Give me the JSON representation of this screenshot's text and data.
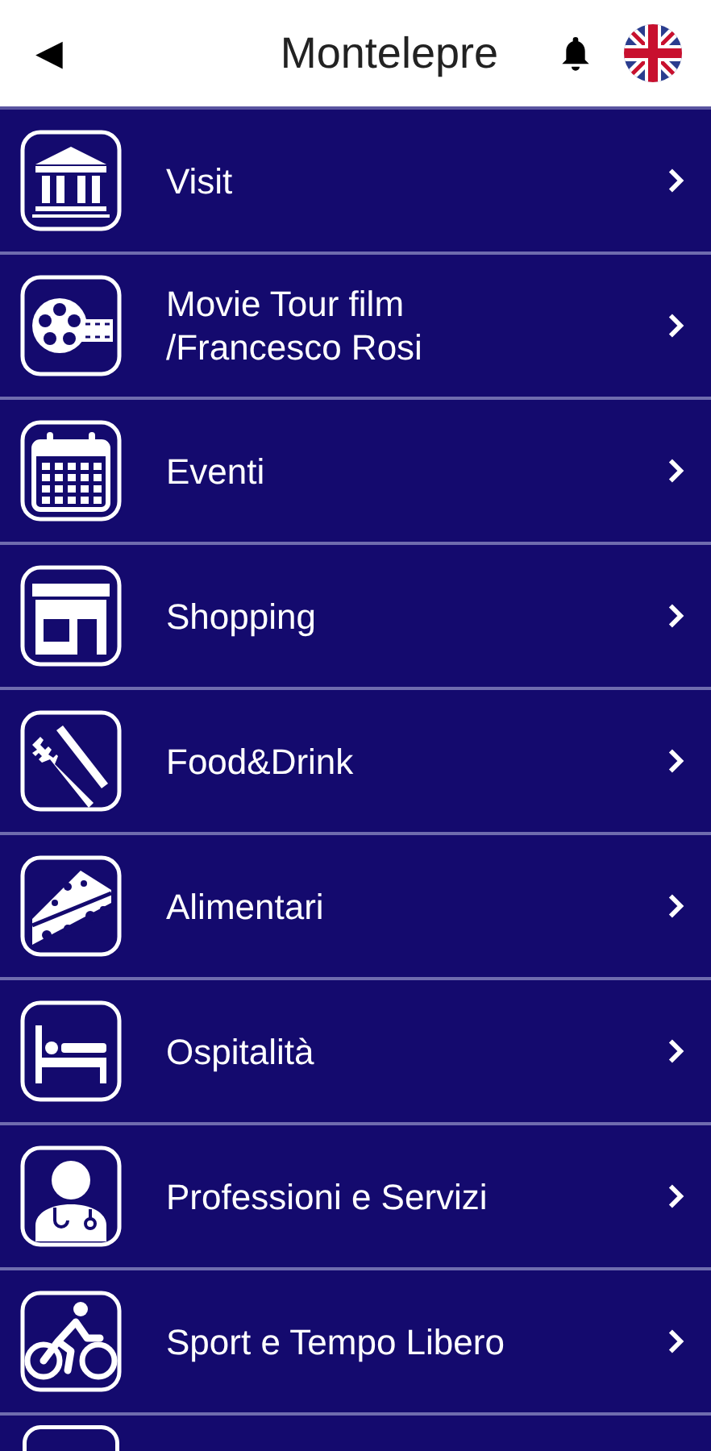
{
  "header": {
    "back": "◀",
    "title": "Montelepre"
  },
  "menu": [
    {
      "label": "Visit"
    },
    {
      "label": "Movie Tour film /Francesco Rosi"
    },
    {
      "label": "Eventi"
    },
    {
      "label": "Shopping"
    },
    {
      "label": "Food&Drink"
    },
    {
      "label": "Alimentari"
    },
    {
      "label": "Ospitalità"
    },
    {
      "label": "Professioni e Servizi"
    },
    {
      "label": "Sport e Tempo Libero"
    }
  ]
}
